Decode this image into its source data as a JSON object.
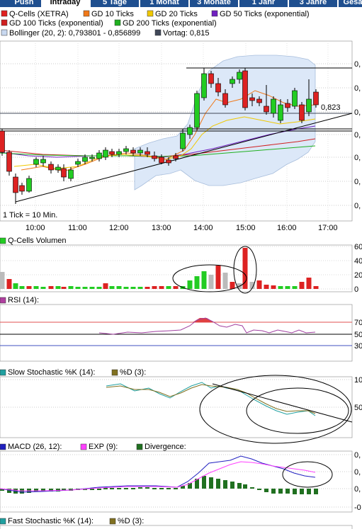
{
  "tabs": [
    "Push",
    "Intraday",
    "5 Tage",
    "1 Monat",
    "3 Monate",
    "1 Jahr",
    "3 Jahre",
    "Gesa"
  ],
  "active_tab": "Intraday",
  "legend_main": [
    {
      "text": "Q-Cells (XETRA)",
      "color": "#e02020"
    },
    {
      "text": "GD 10 Ticks",
      "color": "#f07818"
    },
    {
      "text": "GD 20 Ticks",
      "color": "#f0c800"
    },
    {
      "text": "GD 50 Ticks (exponential)",
      "color": "#7020c0"
    },
    {
      "text": "GD 100 Ticks (exponential)",
      "color": "#d02020"
    },
    {
      "text": "GD 200 Ticks (exponential)",
      "color": "#20b020"
    },
    {
      "text": "Bollinger (20, 2): 0,793801 - 0,856899",
      "color": "#c8d8f0"
    },
    {
      "text": "Vortag: 0,815",
      "color": "#404858"
    }
  ],
  "price_marker": "0,823",
  "tick_note": "1 Tick = 10 Min.",
  "time_labels": [
    "10:00",
    "11:00",
    "12:00",
    "13:00",
    "14:00",
    "15:00",
    "16:00",
    "17:00"
  ],
  "axis_main": [
    "0,",
    "0,",
    "0,",
    "0,",
    "0,",
    "0,",
    "0,"
  ],
  "volume_label": "Q-Cells Volumen",
  "volume_axis": [
    "60",
    "40",
    "20",
    "0"
  ],
  "rsi_label": "RSI (14):",
  "rsi_axis": [
    "70",
    "50",
    "30"
  ],
  "slow_label": "Slow Stochastic %K (14):",
  "slow_d_label": "%D (3):",
  "slow_axis": [
    "10",
    "50"
  ],
  "macd_label": "MACD (26, 12):",
  "exp_label": "EXP (9):",
  "div_label": "Divergence:",
  "macd_axis": [
    "0,",
    "0,",
    "0,",
    "-0"
  ],
  "fast_label": "Fast Stochastic %K (14):",
  "fast_d_label": "%D (3):",
  "colors": {
    "up": "#22cc22",
    "down": "#dd2222",
    "boll": "#dce8f8",
    "tab": "#1f4f8f"
  },
  "chart_data": [
    {
      "type": "candlestick",
      "title": "Q-Cells (XETRA)",
      "x_unit": "10-minute ticks",
      "x_range": [
        "09:00",
        "17:30"
      ],
      "previous_close": 0.815,
      "bollinger": [
        0.793801,
        0.856899
      ],
      "candles_relative": "approximate shape only; y axis values are cut off in the screenshot"
    },
    {
      "type": "bar",
      "title": "Q-Cells Volumen",
      "ylim": [
        0,
        60
      ]
    },
    {
      "type": "line",
      "title": "RSI (14)",
      "reference_levels": [
        70,
        50,
        30
      ]
    },
    {
      "type": "line",
      "title": "Slow Stochastic %K (14) / %D (3)"
    },
    {
      "type": "line",
      "title": "MACD (26, 12) / EXP (9) / Divergence"
    }
  ]
}
